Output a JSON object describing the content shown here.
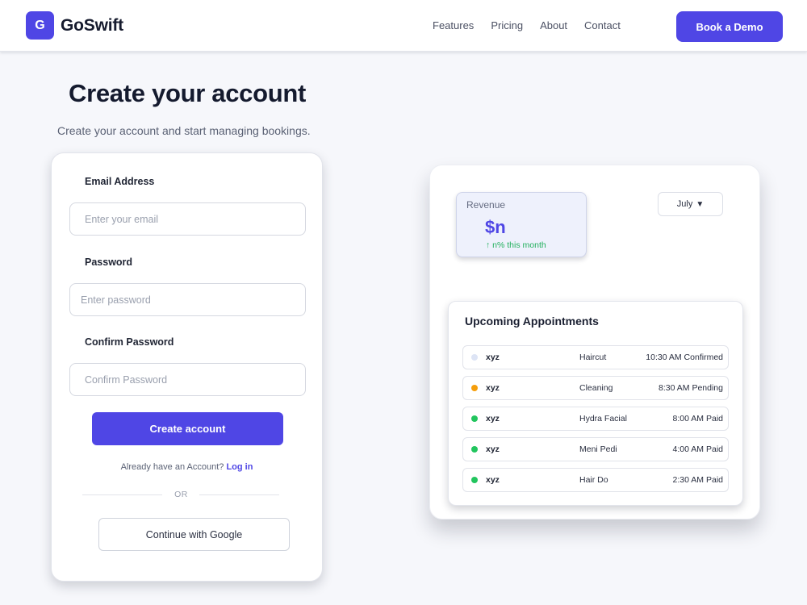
{
  "brand": {
    "logo_letter": "G",
    "name": "GoSwift"
  },
  "nav": {
    "items": [
      "Features",
      "Pricing",
      "About",
      "Contact"
    ],
    "cta_label": "Book a Demo"
  },
  "hero": {
    "title": "Create your account",
    "subtitle": "Create your account and start managing bookings."
  },
  "form": {
    "email": {
      "label": "Email Address",
      "placeholder": "Enter your email",
      "value": ""
    },
    "password": {
      "label": "Password",
      "placeholder": "Enter password",
      "value": ""
    },
    "confirm": {
      "label": "Confirm Password",
      "placeholder": "Confirm Password",
      "value": ""
    },
    "submit_label": "Create account",
    "login_prompt": "Already have an Account?",
    "login_link": "Log in",
    "divider_text": "OR",
    "google_label": "Continue with Google"
  },
  "dashboard": {
    "revenue": {
      "label": "Revenue",
      "value": "$n",
      "change": "↑ n% this month"
    },
    "month_selector": {
      "value": "July",
      "caret": "▼"
    },
    "appointments": {
      "title": "Upcoming Appointments",
      "rows": [
        {
          "name": "xyz",
          "service": "Haircut",
          "time": "10:30 AM Confirmed",
          "dot_color": "#dde4f5"
        },
        {
          "name": "xyz",
          "service": "Cleaning",
          "time": "8:30 AM Pending",
          "dot_color": "#f59e0b"
        },
        {
          "name": "xyz",
          "service": "Hydra Facial",
          "time": "8:00 AM Paid",
          "dot_color": "#22c55e"
        },
        {
          "name": "xyz",
          "service": "Meni Pedi",
          "time": "4:00 AM Paid",
          "dot_color": "#22c55e"
        },
        {
          "name": "xyz",
          "service": "Hair Do",
          "time": "2:30 AM Paid",
          "dot_color": "#22c55e"
        }
      ]
    }
  },
  "colors": {
    "accent": "#4f46e5",
    "success": "#22b05d",
    "background": "#f6f7fb"
  }
}
